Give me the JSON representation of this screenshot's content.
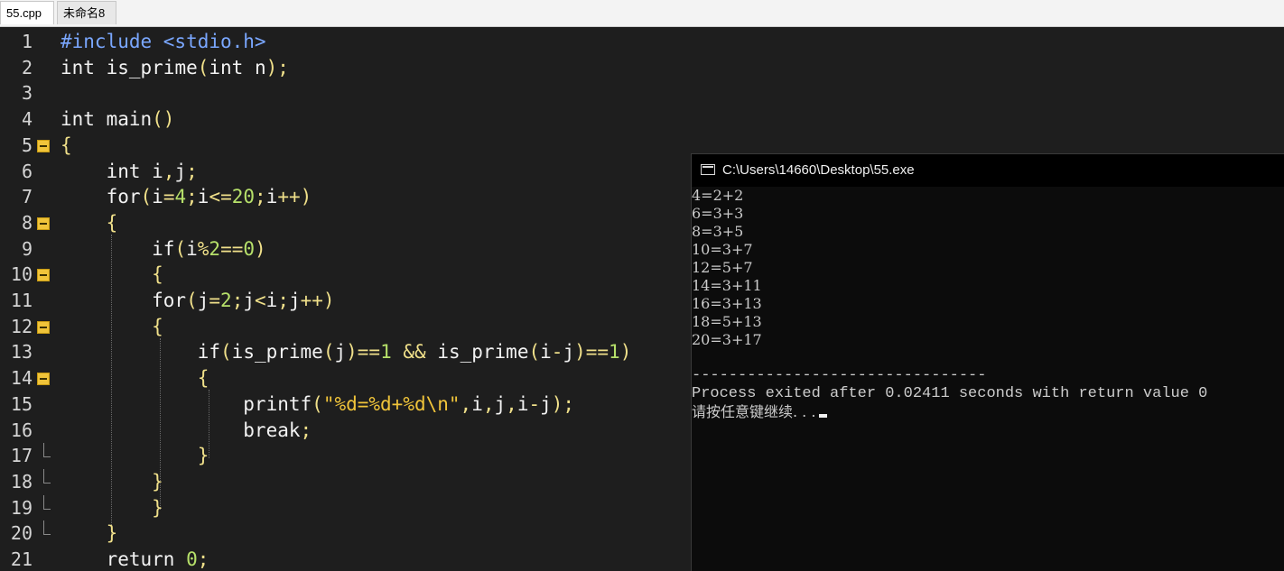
{
  "tabs": [
    {
      "label": "55.cpp",
      "active": true
    },
    {
      "label": "未命名8",
      "active": false
    }
  ],
  "editor": {
    "lines": [
      {
        "number": "1",
        "fold": "none",
        "segments": [
          {
            "t": "#include <stdio.h>",
            "c": "pre"
          }
        ]
      },
      {
        "number": "2",
        "fold": "none",
        "segments": [
          {
            "t": "int",
            "c": "kw"
          },
          {
            "t": " is_prime",
            "c": "id"
          },
          {
            "t": "(",
            "c": "sym"
          },
          {
            "t": "int",
            "c": "kw"
          },
          {
            "t": " n",
            "c": "id"
          },
          {
            "t": ");",
            "c": "sym"
          }
        ]
      },
      {
        "number": "3",
        "fold": "none",
        "segments": []
      },
      {
        "number": "4",
        "fold": "none",
        "segments": [
          {
            "t": "int",
            "c": "kw"
          },
          {
            "t": " main",
            "c": "id"
          },
          {
            "t": "()",
            "c": "sym"
          }
        ]
      },
      {
        "number": "5",
        "fold": "open",
        "segments": [
          {
            "t": "{",
            "c": "sym"
          }
        ]
      },
      {
        "number": "6",
        "fold": "none",
        "segments": [
          {
            "t": "    int",
            "c": "kw"
          },
          {
            "t": " i",
            "c": "id"
          },
          {
            "t": ",",
            "c": "sym"
          },
          {
            "t": "j",
            "c": "id"
          },
          {
            "t": ";",
            "c": "sym"
          }
        ]
      },
      {
        "number": "7",
        "fold": "none",
        "segments": [
          {
            "t": "    for",
            "c": "kw"
          },
          {
            "t": "(",
            "c": "sym"
          },
          {
            "t": "i",
            "c": "id"
          },
          {
            "t": "=",
            "c": "sym"
          },
          {
            "t": "4",
            "c": "num"
          },
          {
            "t": ";",
            "c": "sym"
          },
          {
            "t": "i",
            "c": "id"
          },
          {
            "t": "<=",
            "c": "sym"
          },
          {
            "t": "20",
            "c": "num"
          },
          {
            "t": ";",
            "c": "sym"
          },
          {
            "t": "i",
            "c": "id"
          },
          {
            "t": "++)",
            "c": "sym"
          }
        ]
      },
      {
        "number": "8",
        "fold": "open",
        "segments": [
          {
            "t": "    {",
            "c": "sym"
          }
        ]
      },
      {
        "number": "9",
        "fold": "none",
        "segments": [
          {
            "t": "        if",
            "c": "kw"
          },
          {
            "t": "(",
            "c": "sym"
          },
          {
            "t": "i",
            "c": "id"
          },
          {
            "t": "%",
            "c": "sym"
          },
          {
            "t": "2",
            "c": "num"
          },
          {
            "t": "==",
            "c": "sym"
          },
          {
            "t": "0",
            "c": "num"
          },
          {
            "t": ")",
            "c": "sym"
          }
        ]
      },
      {
        "number": "10",
        "fold": "open",
        "segments": [
          {
            "t": "        {",
            "c": "sym"
          }
        ]
      },
      {
        "number": "11",
        "fold": "none",
        "segments": [
          {
            "t": "        for",
            "c": "kw"
          },
          {
            "t": "(",
            "c": "sym"
          },
          {
            "t": "j",
            "c": "id"
          },
          {
            "t": "=",
            "c": "sym"
          },
          {
            "t": "2",
            "c": "num"
          },
          {
            "t": ";",
            "c": "sym"
          },
          {
            "t": "j",
            "c": "id"
          },
          {
            "t": "<",
            "c": "sym"
          },
          {
            "t": "i",
            "c": "id"
          },
          {
            "t": ";",
            "c": "sym"
          },
          {
            "t": "j",
            "c": "id"
          },
          {
            "t": "++)",
            "c": "sym"
          }
        ]
      },
      {
        "number": "12",
        "fold": "open",
        "segments": [
          {
            "t": "        {",
            "c": "sym"
          }
        ]
      },
      {
        "number": "13",
        "fold": "none",
        "segments": [
          {
            "t": "            if",
            "c": "kw"
          },
          {
            "t": "(",
            "c": "sym"
          },
          {
            "t": "is_prime",
            "c": "id"
          },
          {
            "t": "(",
            "c": "sym"
          },
          {
            "t": "j",
            "c": "id"
          },
          {
            "t": ")==",
            "c": "sym"
          },
          {
            "t": "1",
            "c": "num"
          },
          {
            "t": " && ",
            "c": "sym"
          },
          {
            "t": "is_prime",
            "c": "id"
          },
          {
            "t": "(",
            "c": "sym"
          },
          {
            "t": "i",
            "c": "id"
          },
          {
            "t": "-",
            "c": "sym"
          },
          {
            "t": "j",
            "c": "id"
          },
          {
            "t": ")==",
            "c": "sym"
          },
          {
            "t": "1",
            "c": "num"
          },
          {
            "t": ")",
            "c": "sym"
          }
        ]
      },
      {
        "number": "14",
        "fold": "open",
        "segments": [
          {
            "t": "            {",
            "c": "sym"
          }
        ]
      },
      {
        "number": "15",
        "fold": "none",
        "segments": [
          {
            "t": "                printf",
            "c": "id"
          },
          {
            "t": "(",
            "c": "sym"
          },
          {
            "t": "\"%d=%d+%d\\n\"",
            "c": "str"
          },
          {
            "t": ",",
            "c": "sym"
          },
          {
            "t": "i",
            "c": "id"
          },
          {
            "t": ",",
            "c": "sym"
          },
          {
            "t": "j",
            "c": "id"
          },
          {
            "t": ",",
            "c": "sym"
          },
          {
            "t": "i",
            "c": "id"
          },
          {
            "t": "-",
            "c": "sym"
          },
          {
            "t": "j",
            "c": "id"
          },
          {
            "t": ");",
            "c": "sym"
          }
        ]
      },
      {
        "number": "16",
        "fold": "none",
        "segments": [
          {
            "t": "                break",
            "c": "kw"
          },
          {
            "t": ";",
            "c": "sym"
          }
        ]
      },
      {
        "number": "17",
        "fold": "close",
        "segments": [
          {
            "t": "            }",
            "c": "sym"
          }
        ]
      },
      {
        "number": "18",
        "fold": "close",
        "segments": [
          {
            "t": "        }",
            "c": "sym"
          }
        ]
      },
      {
        "number": "19",
        "fold": "close",
        "segments": [
          {
            "t": "        }",
            "c": "sym"
          }
        ]
      },
      {
        "number": "20",
        "fold": "close",
        "segments": [
          {
            "t": "    }",
            "c": "sym"
          }
        ]
      },
      {
        "number": "21",
        "fold": "none",
        "segments": [
          {
            "t": "    return",
            "c": "kw"
          },
          {
            "t": " ",
            "c": "id"
          },
          {
            "t": "0",
            "c": "num"
          },
          {
            "t": ";",
            "c": "sym"
          }
        ]
      }
    ]
  },
  "console": {
    "title": "C:\\Users\\14660\\Desktop\\55.exe",
    "output": [
      "4=2+2",
      "6=3+3",
      "8=3+5",
      "10=3+7",
      "12=5+7",
      "14=3+11",
      "16=3+13",
      "18=5+13",
      "20=3+17"
    ],
    "blank": "",
    "separator": "--------------------------------",
    "process_line": "Process exited after 0.02411 seconds with return value 0",
    "prompt": "请按任意键继续. . ."
  },
  "colors": {
    "kw": "#f2f2f2",
    "id": "#f2f2f2",
    "sym": "#f0e08a",
    "num": "#b6e06a",
    "str": "#f0c43a",
    "pre": "#7aa7ff"
  }
}
